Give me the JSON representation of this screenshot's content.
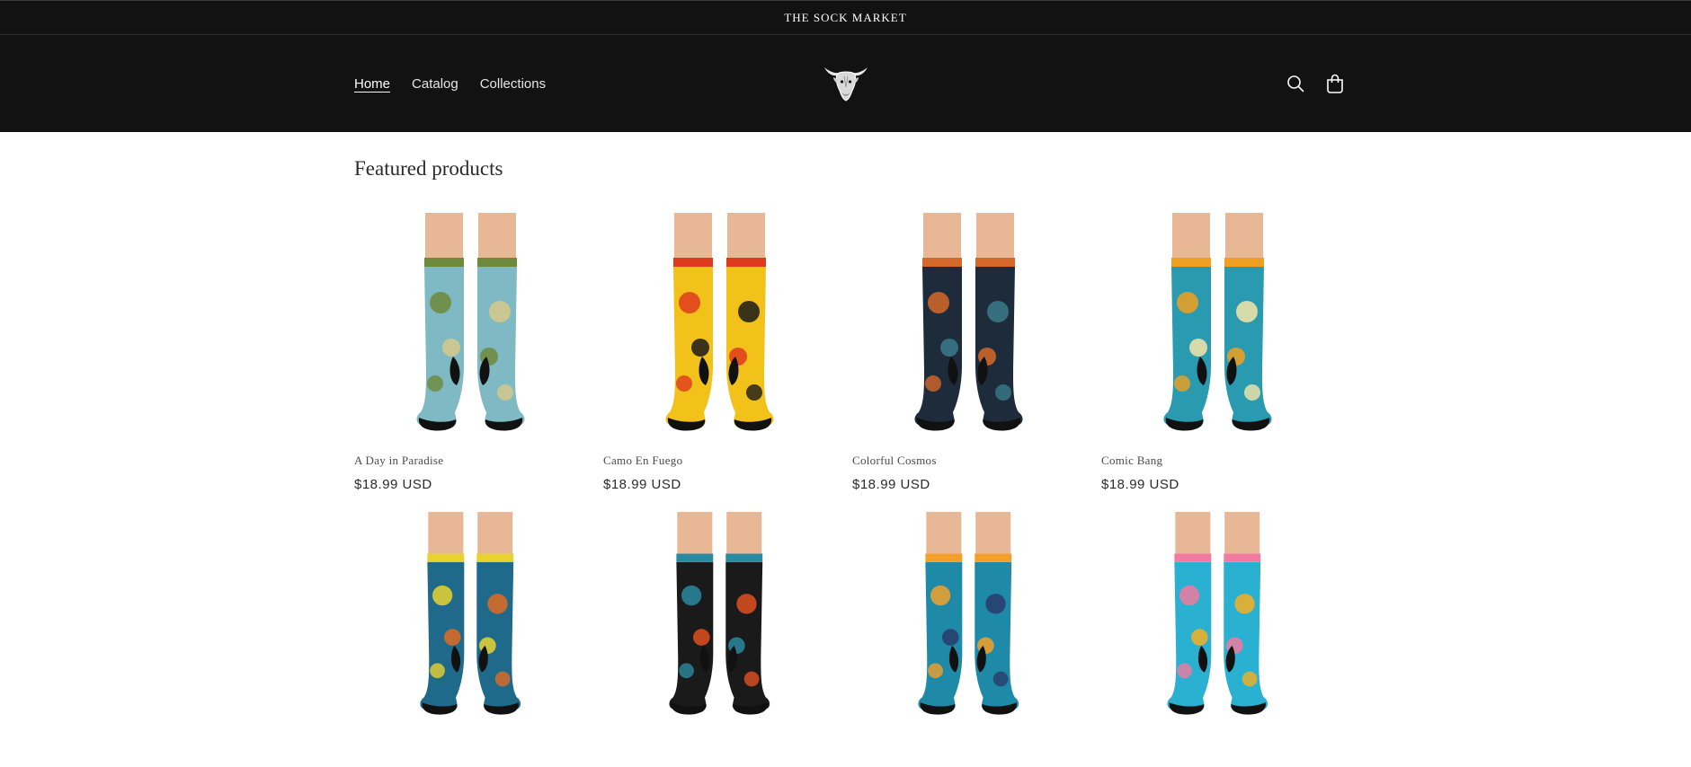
{
  "announcement": {
    "text": "THE SOCK MARKET"
  },
  "nav": {
    "items": [
      {
        "label": "Home",
        "active": true
      },
      {
        "label": "Catalog",
        "active": false
      },
      {
        "label": "Collections",
        "active": false
      }
    ]
  },
  "logo": {
    "icon": "bull-head-icon"
  },
  "header_icons": {
    "search": "search-icon",
    "cart": "cart-icon"
  },
  "featured": {
    "title": "Featured products",
    "products": [
      {
        "name": "A Day in Paradise",
        "price": "$18.99 USD",
        "colors": [
          "#7fb9c4",
          "#6d8a3a",
          "#d8c98a"
        ]
      },
      {
        "name": "Camo En Fuego",
        "price": "$18.99 USD",
        "colors": [
          "#f2c21a",
          "#e03a1e",
          "#1a1a1a"
        ]
      },
      {
        "name": "Colorful Cosmos",
        "price": "$18.99 USD",
        "colors": [
          "#1d2b3a",
          "#d4682a",
          "#3a7a8a"
        ]
      },
      {
        "name": "Comic Bang",
        "price": "$18.99 USD",
        "colors": [
          "#2a9ab0",
          "#f0a020",
          "#f5e6a8"
        ]
      },
      {
        "name": "",
        "price": "",
        "colors": [
          "#1f6a8a",
          "#e8d230",
          "#e06a20"
        ]
      },
      {
        "name": "",
        "price": "",
        "colors": [
          "#1a1a1a",
          "#2a8aa0",
          "#e05020"
        ]
      },
      {
        "name": "",
        "price": "",
        "colors": [
          "#1e8aa8",
          "#f2a02a",
          "#2a3a6a"
        ]
      },
      {
        "name": "",
        "price": "",
        "colors": [
          "#2ab0d0",
          "#f07aa0",
          "#f5b020"
        ]
      }
    ]
  }
}
